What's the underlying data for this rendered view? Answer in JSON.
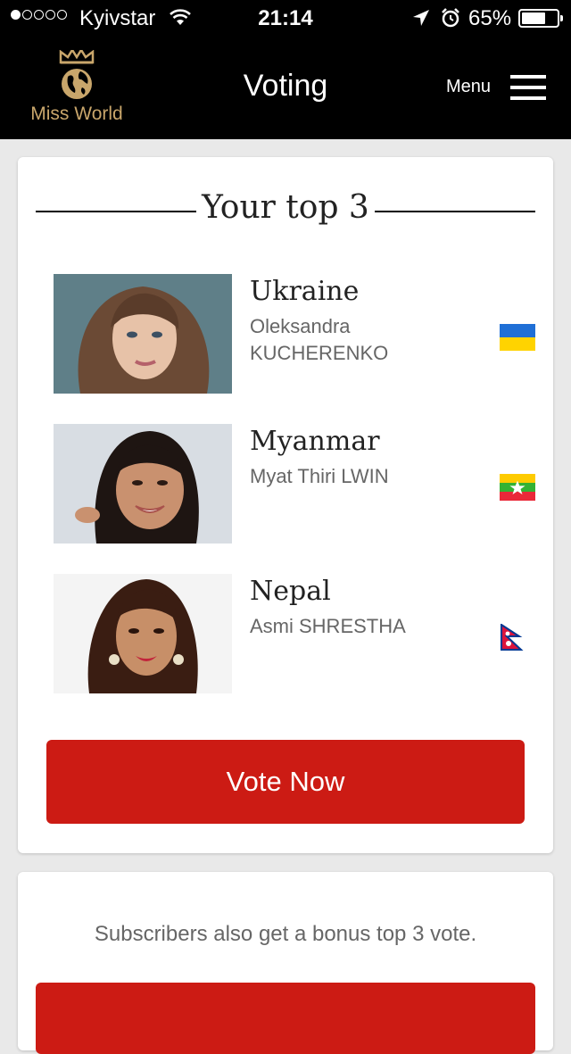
{
  "status_bar": {
    "carrier": "Kyivstar",
    "time": "21:14",
    "battery_percent": "65%",
    "battery_level": 0.65,
    "signal_bars_filled": 1,
    "signal_bars_total": 5
  },
  "header": {
    "logo_text": "Miss World",
    "title": "Voting",
    "menu_label": "Menu"
  },
  "top3": {
    "title": "Your top 3",
    "contestants": [
      {
        "country": "Ukraine",
        "name": "Oleksandra KUCHERENKO",
        "flag": "ukraine-flag"
      },
      {
        "country": "Myanmar",
        "name": "Myat Thiri LWIN",
        "flag": "myanmar-flag"
      },
      {
        "country": "Nepal",
        "name": "Asmi SHRESTHA",
        "flag": "nepal-flag"
      }
    ],
    "vote_button": "Vote Now"
  },
  "subscribers": {
    "text": "Subscribers also get a bonus top 3 vote."
  },
  "colors": {
    "accent_red": "#cc1b14",
    "header_bg": "#000000",
    "logo_gold": "#c9a66b",
    "page_bg": "#e9e9e9"
  }
}
